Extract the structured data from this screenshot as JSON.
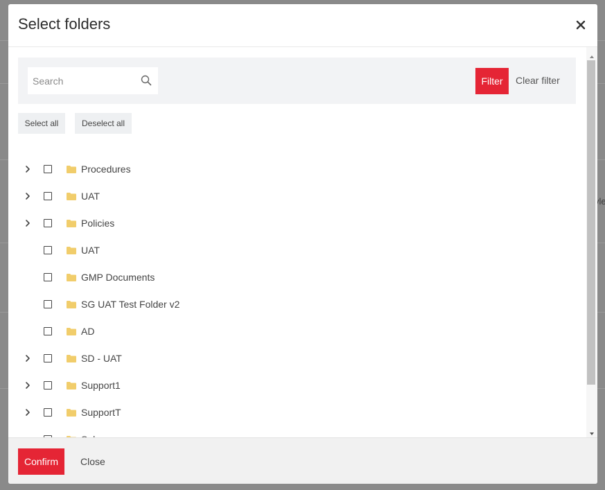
{
  "dialog": {
    "title": "Select folders",
    "close_icon": "close-icon"
  },
  "filter_bar": {
    "search_placeholder": "Search",
    "search_value": "",
    "filter_label": "Filter",
    "clear_filter_label": "Clear filter"
  },
  "selection": {
    "select_all_label": "Select all",
    "deselect_all_label": "Deselect all"
  },
  "folders": [
    {
      "name": "Procedures",
      "expandable": true,
      "checked": false
    },
    {
      "name": "UAT",
      "expandable": true,
      "checked": false
    },
    {
      "name": "Policies",
      "expandable": true,
      "checked": false
    },
    {
      "name": "UAT",
      "expandable": false,
      "checked": false
    },
    {
      "name": "GMP Documents",
      "expandable": false,
      "checked": false
    },
    {
      "name": "SG UAT Test Folder v2",
      "expandable": false,
      "checked": false
    },
    {
      "name": "AD",
      "expandable": false,
      "checked": false
    },
    {
      "name": "SD - UAT",
      "expandable": true,
      "checked": false
    },
    {
      "name": "Support1",
      "expandable": true,
      "checked": false
    },
    {
      "name": "SupportT",
      "expandable": true,
      "checked": false
    },
    {
      "name": "Sol",
      "expandable": false,
      "checked": false
    }
  ],
  "footer": {
    "confirm_label": "Confirm",
    "close_label": "Close"
  },
  "background": {
    "fragment": "vle"
  },
  "colors": {
    "accent": "#e52535",
    "folder": "#f1cd6b"
  }
}
